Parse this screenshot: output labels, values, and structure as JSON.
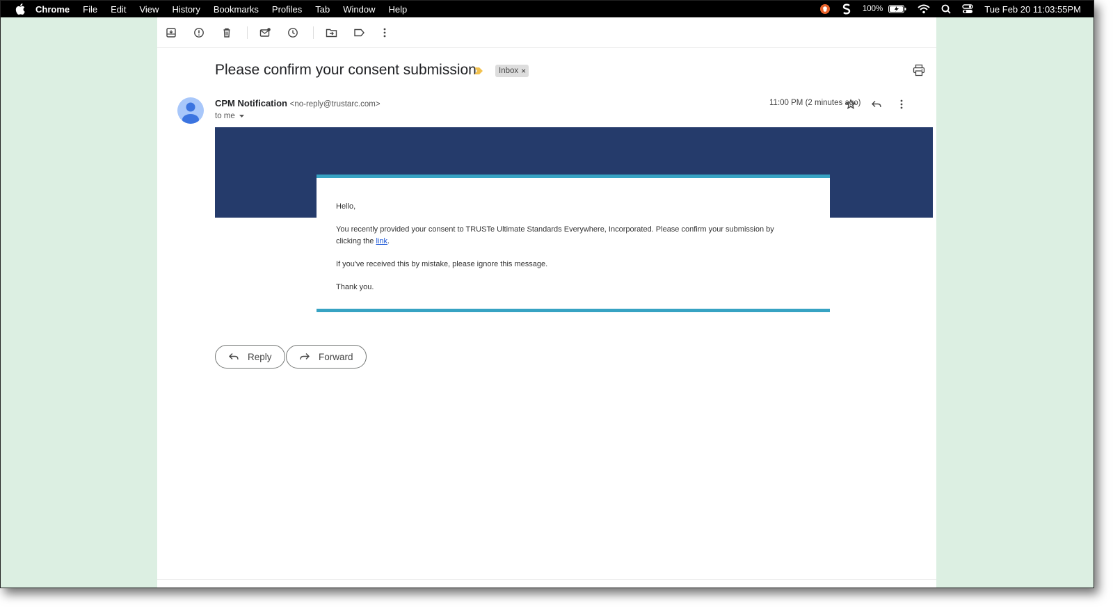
{
  "menubar": {
    "app": "Chrome",
    "items": [
      "File",
      "Edit",
      "View",
      "History",
      "Bookmarks",
      "Profiles",
      "Tab",
      "Window",
      "Help"
    ],
    "battery": "100%",
    "clock": "Tue Feb 20  11:03:55PM"
  },
  "toolbar": {
    "icons": [
      "archive-icon",
      "report-spam-icon",
      "delete-icon",
      "mark-unread-icon",
      "snooze-icon",
      "move-to-icon",
      "label-icon",
      "more-icon"
    ]
  },
  "email": {
    "subject": "Please confirm your consent submission",
    "label": "Inbox",
    "label_remove": "×",
    "sender_name": "CPM Notification",
    "sender_email": "<no-reply@trustarc.com>",
    "recipient": "to me",
    "time": "11:00 PM (2 minutes ago)",
    "body": {
      "greeting": "Hello,",
      "line1": "You recently provided your consent to TRUSTe Ultimate Standards Everywhere, Incorporated. Please confirm your submission by",
      "line2_prefix": "clicking the ",
      "link_text": "link",
      "line2_suffix": ".",
      "line3": "If you've received this by mistake, please ignore this message.",
      "closing": "Thank you."
    }
  },
  "actions": {
    "reply": "Reply",
    "forward": "Forward"
  },
  "colors": {
    "banner": "#253b6b",
    "accent": "#37a3c3",
    "background": "#dcefe2",
    "importance": "#f2c14e"
  }
}
